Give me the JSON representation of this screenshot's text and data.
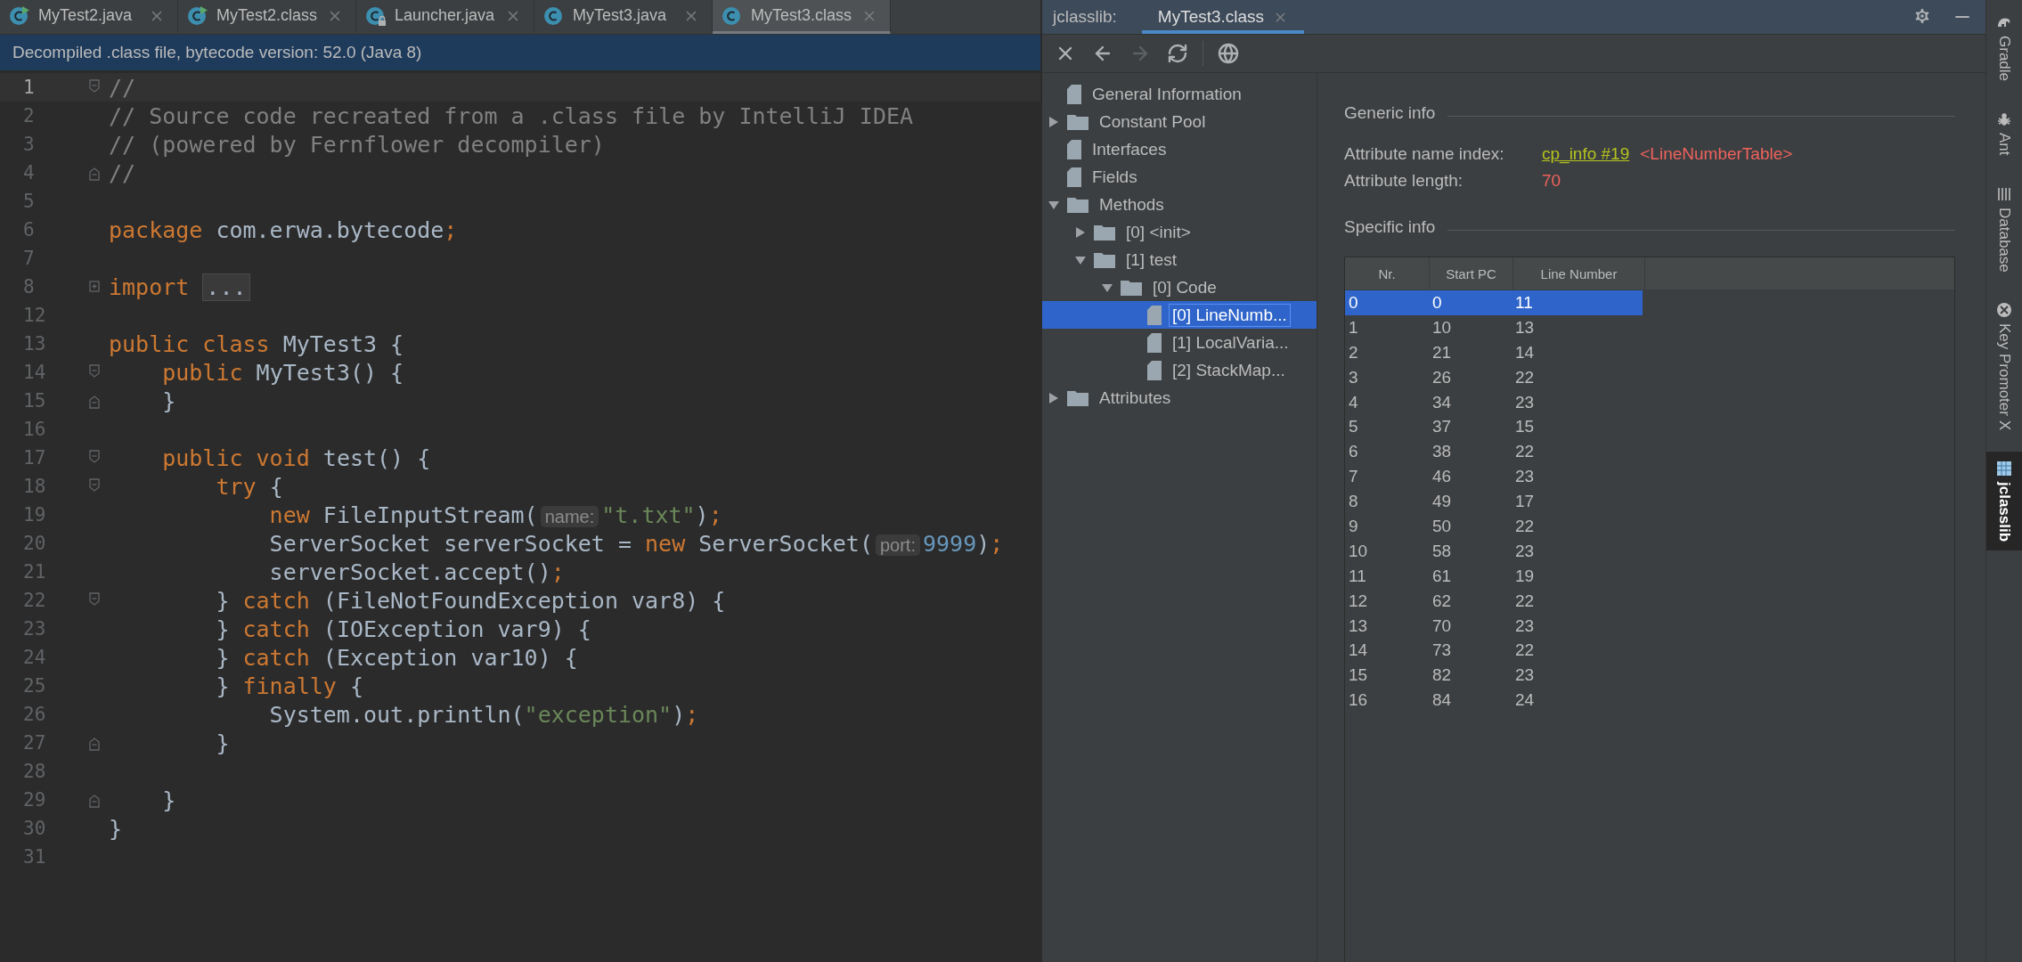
{
  "editor_tabs": [
    {
      "label": "MyTest2.java",
      "kind": "runnable",
      "selected": false
    },
    {
      "label": "MyTest2.class",
      "kind": "runnable",
      "selected": false
    },
    {
      "label": "Launcher.java",
      "kind": "locked",
      "selected": false
    },
    {
      "label": "MyTest3.java",
      "kind": "plain",
      "selected": false
    },
    {
      "label": "MyTest3.class",
      "kind": "plain",
      "selected": true
    }
  ],
  "banner": "Decompiled .class file, bytecode version: 52.0 (Java 8)",
  "code": [
    {
      "n": "1",
      "current": true,
      "kind": "open",
      "tokens": [
        {
          "kind": "cm",
          "text": "//"
        }
      ]
    },
    {
      "n": "2",
      "current": false,
      "tokens": [
        {
          "kind": "cm",
          "text": "// Source code recreated from a .class file by IntelliJ IDEA"
        }
      ]
    },
    {
      "n": "3",
      "current": false,
      "tokens": [
        {
          "kind": "cm",
          "text": "// (powered by Fernflower decompiler)"
        }
      ]
    },
    {
      "n": "4",
      "current": false,
      "kind": "close",
      "tokens": [
        {
          "kind": "cm",
          "text": "//"
        }
      ]
    },
    {
      "n": "5",
      "current": false
    },
    {
      "n": "6",
      "current": false,
      "tokens": [
        {
          "kind": "kw",
          "text": "package"
        },
        {
          "kind": "txt",
          "text": " com.erwa.bytecode"
        },
        {
          "kind": "kw",
          "text": ";"
        }
      ]
    },
    {
      "n": "7",
      "current": false
    },
    {
      "n": "8",
      "current": false,
      "kind": "collapsed",
      "tokens": [
        {
          "kind": "kw",
          "text": "import "
        },
        {
          "kind": "folded",
          "text": "..."
        }
      ]
    },
    {
      "n": "12",
      "current": false
    },
    {
      "n": "13",
      "current": false,
      "tokens": [
        {
          "kind": "kw",
          "text": "public class "
        },
        {
          "kind": "txt",
          "text": "MyTest3 {"
        }
      ]
    },
    {
      "n": "14",
      "current": false,
      "kind": "open",
      "tokens": [
        {
          "kind": "kw",
          "text": "    public "
        },
        {
          "kind": "txt",
          "text": "MyTest3() {"
        }
      ]
    },
    {
      "n": "15",
      "current": false,
      "kind": "close",
      "tokens": [
        {
          "kind": "txt",
          "text": "    }"
        }
      ]
    },
    {
      "n": "16",
      "current": false
    },
    {
      "n": "17",
      "current": false,
      "kind": "open",
      "tokens": [
        {
          "kind": "kw",
          "text": "    public void "
        },
        {
          "kind": "txt",
          "text": "test() {"
        }
      ]
    },
    {
      "n": "18",
      "current": false,
      "kind": "open",
      "tokens": [
        {
          "kind": "kw",
          "text": "        try "
        },
        {
          "kind": "txt",
          "text": "{"
        }
      ]
    },
    {
      "n": "19",
      "current": false,
      "tokens": [
        {
          "kind": "kw",
          "text": "            new "
        },
        {
          "kind": "txt",
          "text": "FileInputStream("
        },
        {
          "kind": "hint",
          "text": "name:"
        },
        {
          "kind": "str",
          "text": "\"t.txt\""
        },
        {
          "kind": "txt",
          "text": ")"
        },
        {
          "kind": "kw",
          "text": ";"
        }
      ]
    },
    {
      "n": "20",
      "current": false,
      "tokens": [
        {
          "kind": "txt",
          "text": "            ServerSocket serverSocket = "
        },
        {
          "kind": "kw",
          "text": "new "
        },
        {
          "kind": "txt",
          "text": "ServerSocket("
        },
        {
          "kind": "hint",
          "text": "port:"
        },
        {
          "kind": "num",
          "text": "9999"
        },
        {
          "kind": "txt",
          "text": ")"
        },
        {
          "kind": "kw",
          "text": ";"
        }
      ]
    },
    {
      "n": "21",
      "current": false,
      "tokens": [
        {
          "kind": "txt",
          "text": "            serverSocket.accept()"
        },
        {
          "kind": "kw",
          "text": ";"
        }
      ]
    },
    {
      "n": "22",
      "current": false,
      "kind": "open",
      "tokens": [
        {
          "kind": "txt",
          "text": "        } "
        },
        {
          "kind": "kw",
          "text": "catch "
        },
        {
          "kind": "txt",
          "text": "(FileNotFoundException var8) {"
        }
      ]
    },
    {
      "n": "23",
      "current": false,
      "tokens": [
        {
          "kind": "txt",
          "text": "        } "
        },
        {
          "kind": "kw",
          "text": "catch "
        },
        {
          "kind": "txt",
          "text": "(IOException var9) {"
        }
      ]
    },
    {
      "n": "24",
      "current": false,
      "tokens": [
        {
          "kind": "txt",
          "text": "        } "
        },
        {
          "kind": "kw",
          "text": "catch "
        },
        {
          "kind": "txt",
          "text": "(Exception var10) {"
        }
      ]
    },
    {
      "n": "25",
      "current": false,
      "tokens": [
        {
          "kind": "txt",
          "text": "        } "
        },
        {
          "kind": "kw",
          "text": "finally "
        },
        {
          "kind": "txt",
          "text": "{"
        }
      ]
    },
    {
      "n": "26",
      "current": false,
      "tokens": [
        {
          "kind": "txt",
          "text": "            System.out.println("
        },
        {
          "kind": "str",
          "text": "\"exception\""
        },
        {
          "kind": "txt",
          "text": ")"
        },
        {
          "kind": "kw",
          "text": ";"
        }
      ]
    },
    {
      "n": "27",
      "current": false,
      "kind": "close",
      "tokens": [
        {
          "kind": "txt",
          "text": "        }"
        }
      ]
    },
    {
      "n": "28",
      "current": false
    },
    {
      "n": "29",
      "current": false,
      "kind": "close",
      "tokens": [
        {
          "kind": "txt",
          "text": "    }"
        }
      ]
    },
    {
      "n": "30",
      "current": false,
      "tokens": [
        {
          "kind": "txt",
          "text": "}"
        }
      ]
    },
    {
      "n": "31",
      "current": false
    }
  ],
  "tool_window": {
    "title": "jclasslib:",
    "tabs": [
      {
        "label": "MyTest3.class",
        "selected": true
      }
    ],
    "toolbar": [
      {
        "kind": "close",
        "disabled": false
      },
      {
        "kind": "back",
        "disabled": false
      },
      {
        "kind": "forward",
        "disabled": true
      },
      {
        "kind": "refresh",
        "disabled": false
      },
      {
        "kind": "separator"
      },
      {
        "kind": "web",
        "disabled": false
      }
    ],
    "tree": [
      {
        "label": "General Information",
        "kind": "file",
        "selected": false
      },
      {
        "label": "Constant Pool",
        "kind": "folder",
        "expanded": false,
        "selected": false
      },
      {
        "label": "Interfaces",
        "kind": "file",
        "selected": false
      },
      {
        "label": "Fields",
        "kind": "file",
        "selected": false
      },
      {
        "label": "Methods",
        "kind": "folder",
        "expanded": true,
        "selected": false,
        "children": [
          {
            "label": "[0] <init>",
            "kind": "folder",
            "expanded": false,
            "selected": false
          },
          {
            "label": "[1] test",
            "kind": "folder",
            "expanded": true,
            "selected": false,
            "children": [
              {
                "label": "[0] Code",
                "kind": "folder",
                "expanded": true,
                "selected": false,
                "children": [
                  {
                    "label": "[0] LineNumb...",
                    "kind": "file",
                    "selected": true
                  },
                  {
                    "label": "[1] LocalVaria...",
                    "kind": "file",
                    "selected": false
                  },
                  {
                    "label": "[2] StackMap...",
                    "kind": "file",
                    "selected": false
                  }
                ]
              }
            ]
          }
        ]
      },
      {
        "label": "Attributes",
        "kind": "folder",
        "expanded": false,
        "selected": false
      }
    ],
    "generic_info": {
      "heading": "Generic info",
      "rows": [
        {
          "label": "Attribute name index:",
          "link": "cp_info #19",
          "value": "<LineNumberTable>"
        },
        {
          "label": "Attribute length:",
          "value": "70"
        }
      ]
    },
    "specific_info": {
      "heading": "Specific info",
      "table": {
        "columns": [
          "Nr.",
          "Start PC",
          "Line Number"
        ],
        "rows": [
          {
            "cells": [
              "0",
              "0",
              "11"
            ],
            "selected": true
          },
          {
            "cells": [
              "1",
              "10",
              "13"
            ],
            "selected": false
          },
          {
            "cells": [
              "2",
              "21",
              "14"
            ],
            "selected": false
          },
          {
            "cells": [
              "3",
              "26",
              "22"
            ],
            "selected": false
          },
          {
            "cells": [
              "4",
              "34",
              "23"
            ],
            "selected": false
          },
          {
            "cells": [
              "5",
              "37",
              "15"
            ],
            "selected": false
          },
          {
            "cells": [
              "6",
              "38",
              "22"
            ],
            "selected": false
          },
          {
            "cells": [
              "7",
              "46",
              "23"
            ],
            "selected": false
          },
          {
            "cells": [
              "8",
              "49",
              "17"
            ],
            "selected": false
          },
          {
            "cells": [
              "9",
              "50",
              "22"
            ],
            "selected": false
          },
          {
            "cells": [
              "10",
              "58",
              "23"
            ],
            "selected": false
          },
          {
            "cells": [
              "11",
              "61",
              "19"
            ],
            "selected": false
          },
          {
            "cells": [
              "12",
              "62",
              "22"
            ],
            "selected": false
          },
          {
            "cells": [
              "13",
              "70",
              "23"
            ],
            "selected": false
          },
          {
            "cells": [
              "14",
              "73",
              "22"
            ],
            "selected": false
          },
          {
            "cells": [
              "15",
              "82",
              "23"
            ],
            "selected": false
          },
          {
            "cells": [
              "16",
              "84",
              "24"
            ],
            "selected": false
          }
        ]
      }
    }
  },
  "side_bar": [
    {
      "label": "Gradle",
      "kind": "gradle",
      "selected": false
    },
    {
      "label": "Ant",
      "kind": "ant",
      "selected": false
    },
    {
      "label": "Database",
      "kind": "database",
      "selected": false
    },
    {
      "label": "Key Promoter X",
      "kind": "keypromoter",
      "selected": false
    },
    {
      "label": "jclasslib",
      "kind": "jclasslib",
      "selected": true
    }
  ]
}
